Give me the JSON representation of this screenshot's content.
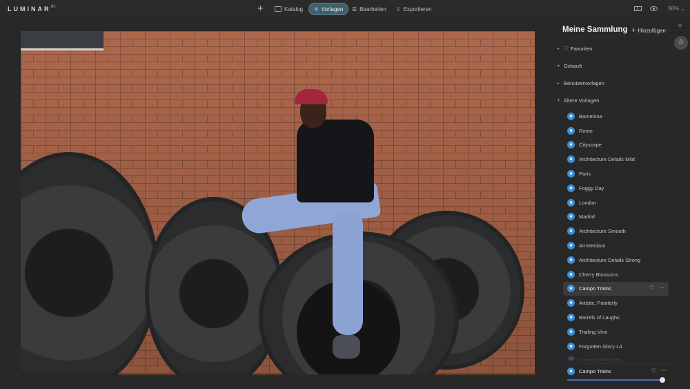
{
  "app": {
    "logo": "LUMINAR",
    "logo_sup": "AI"
  },
  "toolbar": {
    "add_symbol": "+",
    "tabs": [
      {
        "label": "Katalog",
        "icon": "folder-icon"
      },
      {
        "label": "Vorlagen",
        "icon": "presets-icon",
        "active": true
      },
      {
        "label": "Bearbeiten",
        "icon": "sliders-icon"
      },
      {
        "label": "Exportieren",
        "icon": "share-icon"
      }
    ],
    "zoom": "50%",
    "zoom_chevron": "⌄"
  },
  "panel": {
    "title": "Meine Sammlung",
    "add_label": "Hinzufügen",
    "add_symbol": "+",
    "sections": [
      {
        "label": "Favoriten",
        "caret": "▸",
        "icon": "heart-icon",
        "heart": "♡"
      },
      {
        "label": "Gekauft",
        "caret": "▾"
      },
      {
        "label": "Benutzervorlagen",
        "caret": "▸"
      },
      {
        "label": "Ältere Vorlagen",
        "caret": "▾"
      }
    ],
    "presets": [
      "Barcelona",
      "Rome",
      "Cityscape",
      "Architecture Details Mild",
      "Paris",
      "Foggy Day",
      "London",
      "Madrid",
      "Architecture Smooth",
      "Amsterdam",
      "Architecture Details Strong",
      "Cherry Blossoms",
      "Campo Trains",
      "Artistic, Painterly",
      "Barrels of Laughs",
      "Trailing Vine",
      "Forgotten Glory L4",
      "Autumn Red Dusk"
    ],
    "active_preset_index": 12,
    "preset_actions": {
      "heart": "♡",
      "more": "···"
    },
    "current": {
      "name": "Campo Trains",
      "amount": 1.0
    }
  },
  "strip": {
    "wand_icon": "✧",
    "star_icon": "☆"
  }
}
